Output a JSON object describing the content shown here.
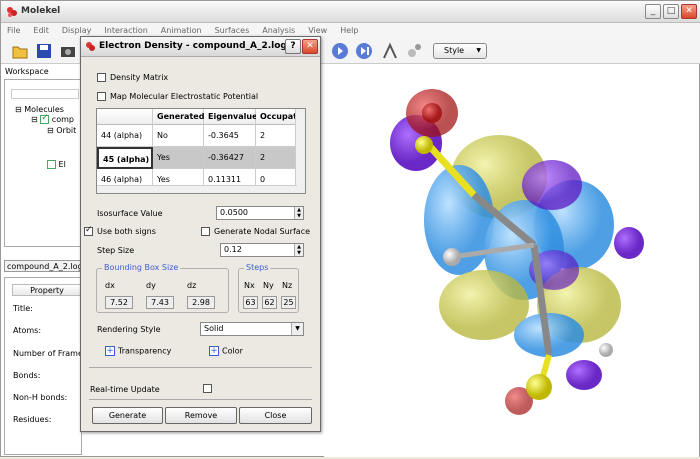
{
  "app": {
    "title": "Molekel",
    "minimize": "_",
    "maximize": "□",
    "close": "✕"
  },
  "menu": [
    "File",
    "Edit",
    "Display",
    "Interaction",
    "Animation",
    "Surfaces",
    "Analysis",
    "View",
    "Help"
  ],
  "toolbar": {
    "style_label": "Style"
  },
  "workspace": {
    "label": "Workspace",
    "tree": {
      "molecules": "Molecules",
      "compound_short": "comp",
      "orbitals_short": "Orbit",
      "el_short": "El"
    },
    "file_tab": "compound_A_2.log",
    "property_header": "Property",
    "properties": [
      "Title:",
      "Atoms:",
      "Number of Frames",
      "Bonds:",
      "Non-H bonds:",
      "Residues:"
    ]
  },
  "dialog": {
    "title": "Electron Density - compound_A_2.log",
    "help_btn": "?",
    "close_btn": "✕",
    "density_matrix": "Density Matrix",
    "map_mep": "Map Molecular Electrostatic Potential",
    "table": {
      "columns": [
        "",
        "Generated",
        "Eigenvalue",
        "Occupatio"
      ],
      "rows": [
        {
          "name": "44 (alpha)",
          "generated": "No",
          "eigen": "-0.3645",
          "occ": "2"
        },
        {
          "name": "45 (alpha)",
          "generated": "Yes",
          "eigen": "-0.36427",
          "occ": "2"
        },
        {
          "name": "46 (alpha)",
          "generated": "Yes",
          "eigen": "0.11311",
          "occ": "0"
        }
      ]
    },
    "isosurface_label": "Isosurface Value",
    "isosurface_value": "0.0500",
    "use_both_signs": "Use both signs",
    "generate_nodal": "Generate Nodal Surface",
    "step_size_label": "Step Size",
    "step_size_value": "0.12",
    "bbox_title": "Bounding Box Size",
    "bbox_labels": [
      "dx",
      "dy",
      "dz"
    ],
    "bbox_values": [
      "7.52",
      "7.43",
      "2.98"
    ],
    "steps_title": "Steps",
    "steps_labels": [
      "Nx",
      "Ny",
      "Nz"
    ],
    "steps_values": [
      "63",
      "62",
      "25"
    ],
    "rendering_label": "Rendering Style",
    "rendering_value": "Solid",
    "transparency": "Transparency",
    "color": "Color",
    "realtime": "Real-time Update",
    "generate_btn": "Generate",
    "remove_btn": "Remove",
    "close_label": "Close"
  },
  "colors": {
    "accent": "#3a5fcd",
    "positive_lobe": "#4aa3ff",
    "negative_lobe": "#c8c845",
    "oxygen": "#d02020",
    "sulfur": "#e8e020",
    "purple": "#7a20e0"
  }
}
